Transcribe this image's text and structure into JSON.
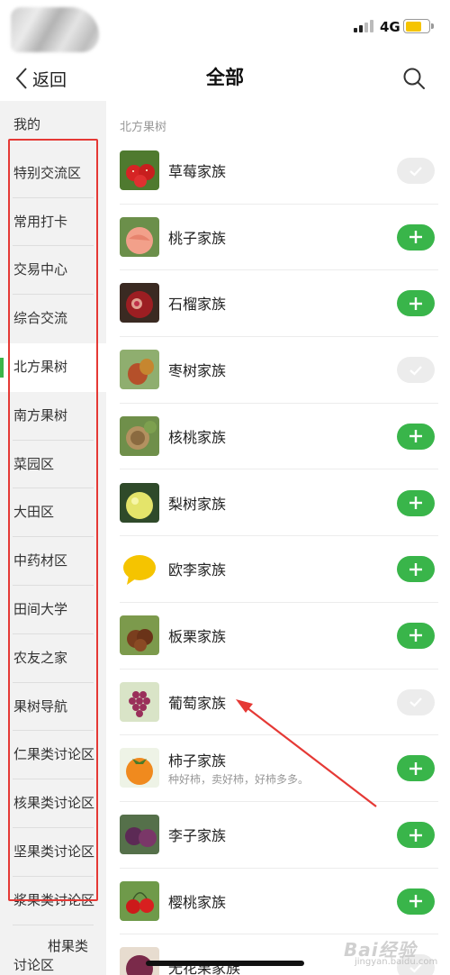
{
  "status_bar": {
    "network": "4G"
  },
  "nav": {
    "back_label": "返回",
    "title": "全部"
  },
  "sidebar": {
    "items": [
      {
        "label": "我的"
      },
      {
        "label": "特别交流区"
      },
      {
        "label": "常用打卡"
      },
      {
        "label": "交易中心"
      },
      {
        "label": "综合交流"
      },
      {
        "label": "北方果树",
        "active": true
      },
      {
        "label": "南方果树"
      },
      {
        "label": "菜园区"
      },
      {
        "label": "大田区"
      },
      {
        "label": "中药材区"
      },
      {
        "label": "田间大学"
      },
      {
        "label": "农友之家"
      },
      {
        "label": "果树导航"
      },
      {
        "label": "仁果类讨论区"
      },
      {
        "label": "核果类讨论区"
      },
      {
        "label": "坚果类讨论区"
      },
      {
        "label": "浆果类讨论区"
      }
    ],
    "last_item_line1": "柑果类",
    "last_item_line2": "讨论区"
  },
  "content": {
    "section_title": "北方果树",
    "rows": [
      {
        "name": "草莓家族",
        "joined": true,
        "thumb": "strawberry"
      },
      {
        "name": "桃子家族",
        "joined": false,
        "thumb": "peach"
      },
      {
        "name": "石榴家族",
        "joined": false,
        "thumb": "pomegranate"
      },
      {
        "name": "枣树家族",
        "joined": true,
        "thumb": "jujube"
      },
      {
        "name": "核桃家族",
        "joined": false,
        "thumb": "walnut"
      },
      {
        "name": "梨树家族",
        "joined": false,
        "thumb": "pear"
      },
      {
        "name": "欧李家族",
        "joined": false,
        "thumb": "chat-bubble"
      },
      {
        "name": "板栗家族",
        "joined": false,
        "thumb": "chestnut"
      },
      {
        "name": "葡萄家族",
        "joined": true,
        "thumb": "grape"
      },
      {
        "name": "柿子家族",
        "sub": "种好柿，卖好柿，好柿多多。",
        "joined": false,
        "thumb": "persimmon"
      },
      {
        "name": "李子家族",
        "joined": false,
        "thumb": "plum"
      },
      {
        "name": "樱桃家族",
        "joined": false,
        "thumb": "cherry"
      },
      {
        "name": "无花果家族",
        "joined": true,
        "thumb": "fig"
      }
    ]
  },
  "watermark": {
    "text": "Bai经验",
    "sub": "jingyan.baidu.com"
  },
  "colors": {
    "accent_green": "#39b54a",
    "annotation_red": "#e53935",
    "battery_yellow": "#f5c400"
  }
}
